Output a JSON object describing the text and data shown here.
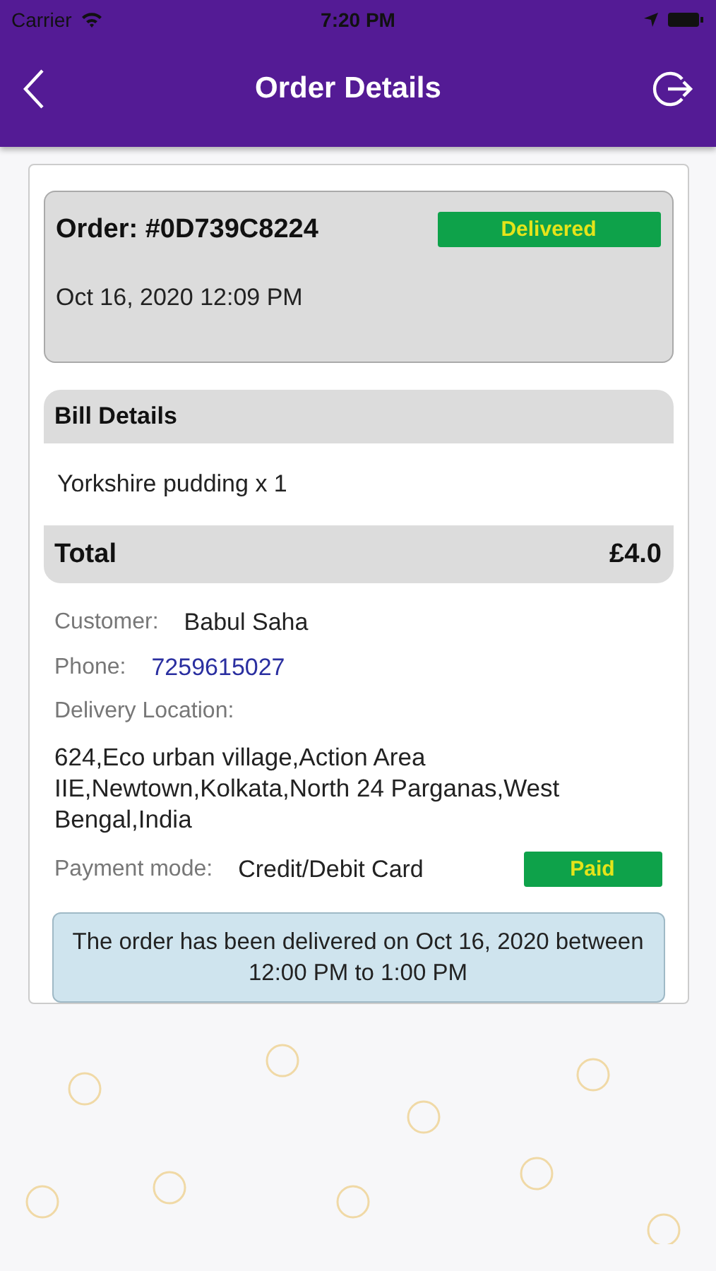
{
  "status_bar": {
    "carrier": "Carrier",
    "time": "7:20 PM"
  },
  "header": {
    "title": "Order Details"
  },
  "order": {
    "number": "Order: #0D739C8224",
    "status": "Delivered",
    "date": "Oct 16, 2020 12:09 PM"
  },
  "bill": {
    "title": "Bill Details",
    "items": [
      "Yorkshire pudding x 1"
    ],
    "total_label": "Total",
    "total": "£4.0"
  },
  "details": [
    {
      "kind": "text",
      "label": "Customer:",
      "value": "Babul Saha"
    },
    {
      "kind": "link",
      "label": "Phone:",
      "value": "7259615027"
    },
    {
      "kind": "block",
      "label": "Delivery Location:",
      "value": "624,Eco urban village,Action Area IIE,Newtown,Kolkata,North 24 Parganas,West Bengal,India"
    },
    {
      "kind": "badge",
      "label": "Payment mode:",
      "value": "Credit/Debit Card",
      "badge": "Paid"
    }
  ],
  "notice": "The order has been delivered on Oct 16, 2020 between 12:00 PM to 1:00 PM"
}
